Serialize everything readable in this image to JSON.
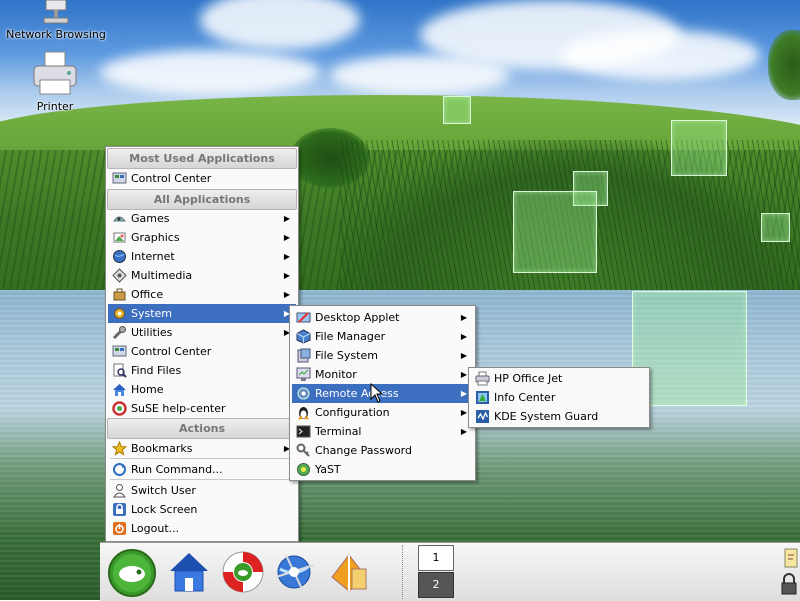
{
  "desktop": {
    "icons": [
      {
        "label": "Network Browsing",
        "icon": "network-browsing-icon"
      },
      {
        "label": "Printer",
        "icon": "printer-icon"
      }
    ]
  },
  "start_menu": {
    "most_used_header": "Most Used Applications",
    "most_used": [
      {
        "label": "Control Center",
        "icon": "control-center-icon"
      }
    ],
    "all_apps_header": "All Applications",
    "all_apps": [
      {
        "label": "Games",
        "icon": "games-icon",
        "submenu": true
      },
      {
        "label": "Graphics",
        "icon": "graphics-icon",
        "submenu": true
      },
      {
        "label": "Internet",
        "icon": "internet-icon",
        "submenu": true
      },
      {
        "label": "Multimedia",
        "icon": "multimedia-icon",
        "submenu": true
      },
      {
        "label": "Office",
        "icon": "office-icon",
        "submenu": true
      },
      {
        "label": "System",
        "icon": "system-icon",
        "submenu": true,
        "active": true
      },
      {
        "label": "Utilities",
        "icon": "utilities-icon",
        "submenu": true
      },
      {
        "label": "Control Center",
        "icon": "control-center-icon"
      },
      {
        "label": "Find Files",
        "icon": "find-files-icon"
      },
      {
        "label": "Home",
        "icon": "home-icon"
      },
      {
        "label": "SuSE help-center",
        "icon": "help-center-icon"
      }
    ],
    "actions_header": "Actions",
    "actions": [
      {
        "label": "Bookmarks",
        "icon": "bookmarks-icon",
        "submenu": true
      },
      {
        "label": "Run Command...",
        "icon": "run-command-icon"
      },
      {
        "label": "Switch User",
        "icon": "switch-user-icon"
      },
      {
        "label": "Lock Screen",
        "icon": "lock-screen-icon"
      },
      {
        "label": "Logout...",
        "icon": "logout-icon"
      }
    ]
  },
  "system_menu": {
    "items": [
      {
        "label": "Desktop Applet",
        "icon": "desktop-applet-icon",
        "submenu": true
      },
      {
        "label": "File Manager",
        "icon": "file-manager-icon",
        "submenu": true
      },
      {
        "label": "File System",
        "icon": "file-system-icon",
        "submenu": true
      },
      {
        "label": "Monitor",
        "icon": "monitor-icon",
        "submenu": true
      },
      {
        "label": "Remote Access",
        "icon": "remote-access-icon",
        "submenu": true,
        "active": true
      },
      {
        "label": "Configuration",
        "icon": "configuration-icon",
        "submenu": true
      },
      {
        "label": "Terminal",
        "icon": "terminal-icon",
        "submenu": true
      },
      {
        "label": "Change Password",
        "icon": "change-password-icon"
      },
      {
        "label": "YaST",
        "icon": "yast-icon"
      }
    ]
  },
  "remote_menu": {
    "items": [
      {
        "label": "HP Office Jet",
        "icon": "hp-office-jet-icon"
      },
      {
        "label": "Info Center",
        "icon": "info-center-icon"
      },
      {
        "label": "KDE System Guard",
        "icon": "kde-system-guard-icon"
      }
    ]
  },
  "taskbar": {
    "launchers": [
      {
        "name": "suse-menu-button",
        "icon": "suse-logo-icon"
      },
      {
        "name": "home-launcher",
        "icon": "home-folder-icon"
      },
      {
        "name": "help-launcher",
        "icon": "lifebuoy-icon"
      },
      {
        "name": "konqueror-launcher",
        "icon": "konqueror-icon"
      },
      {
        "name": "office-launcher",
        "icon": "office-suite-icon"
      }
    ],
    "pager": [
      "1",
      "2"
    ],
    "active_desktop": "2"
  },
  "colors": {
    "menu_highlight": "#3d6fc0",
    "menu_background": "#fafafa"
  }
}
